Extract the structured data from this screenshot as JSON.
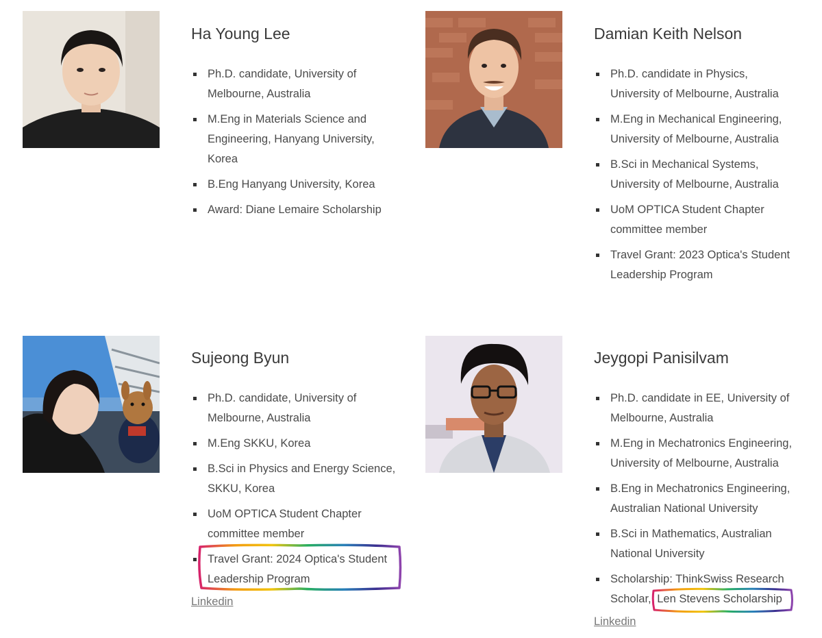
{
  "people": [
    {
      "name": "Ha Young Lee",
      "items": [
        "Ph.D. candidate, University of Melbourne, Australia",
        "M.Eng in Materials Science and Engineering, Hanyang University, Korea",
        "B.Eng Hanyang University, Korea",
        "Award: Diane Lemaire Scholarship"
      ]
    },
    {
      "name": "Damian Keith Nelson",
      "items": [
        "Ph.D. candidate in Physics, University of Melbourne, Australia",
        "M.Eng in Mechanical Engineering, University of Melbourne, Australia",
        "B.Sci in Mechanical Systems, University of Melbourne, Australia",
        "UoM OPTICA Student Chapter committee member",
        "Travel Grant: 2023 Optica's Student Leadership Program"
      ]
    },
    {
      "name": "Sujeong Byun",
      "items": [
        "Ph.D. candidate, University of Melbourne, Australia",
        "M.Eng SKKU, Korea",
        "B.Sci in Physics and Energy Science, SKKU, Korea",
        "UoM OPTICA Student Chapter committee member",
        "Travel Grant: 2024 Optica's Student Leadership Program"
      ],
      "link": "Linkedin"
    },
    {
      "name": "Jeygopi Panisilvam",
      "items": [
        "Ph.D. candidate in EE, University of Melbourne, Australia",
        "M.Eng in Mechatronics Engineering, University of Melbourne, Australia",
        "B.Eng in Mechatronics Engineering, Australian National University",
        "B.Sci in Mathematics, Australian National University"
      ],
      "scholarship_prefix": "Scholarship: ThinkSwiss Research Scholar,",
      "scholarship_highlight": "Len Stevens Scholarship",
      "link": "Linkedin"
    }
  ]
}
